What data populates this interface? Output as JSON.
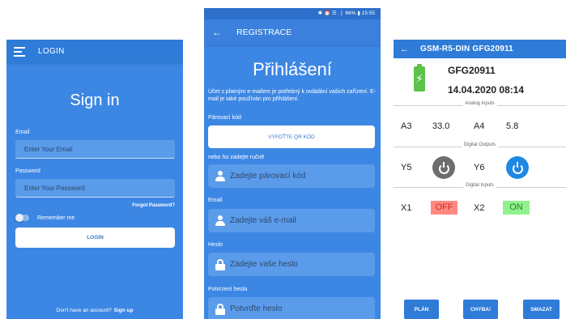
{
  "login": {
    "appbar_title": "LOGIN",
    "heading": "Sign in",
    "email_label": "Email",
    "email_placeholder": "Enter Your Email",
    "password_label": "Password",
    "password_placeholder": "Enter Your Password",
    "forgot_link": "Forgot Password?",
    "remember_label": "Remember me",
    "remember_on": false,
    "login_button": "LOGIN",
    "footer_text": "Don't have an account?",
    "signup_link": "Sign up"
  },
  "registration": {
    "status_text": "✱ ⏰ ☰ .❘ 66% ▮ 15:55",
    "appbar_title": "REGISTRACE",
    "heading": "Přihlášení",
    "description": "Účet s platným e-mailem je potřebný k ovládání vašich zařízení. E-mail je také používán pro přihlášení.",
    "pairing_label": "Párovací kód",
    "qr_button": "VYFOŤTE QR KÓD",
    "manual_label": "nebo ho zadejte ručně",
    "pairing_placeholder": "Zadejte párovací kód",
    "email_label": "Email",
    "email_placeholder": "Zadejte váš e-mail",
    "password_label": "Heslo",
    "password_placeholder": "Zadejte vaše heslo",
    "confirm_label": "Potvrzení hesla",
    "confirm_placeholder": "Potvrďte heslo"
  },
  "device": {
    "appbar_title": "GSM-R5-DIN GFG20911",
    "name": "GFG20911",
    "datetime": "14.04.2020 08:14",
    "analog_section": "Analog inputs",
    "analog": [
      {
        "label": "A3",
        "value": "33.0"
      },
      {
        "label": "A4",
        "value": "5.8"
      }
    ],
    "outputs_section": "Digital Outputs",
    "outputs": [
      {
        "label": "Y5",
        "state": "off"
      },
      {
        "label": "Y6",
        "state": "on"
      }
    ],
    "inputs_section": "Digital Inputs",
    "inputs": [
      {
        "label": "X1",
        "value": "OFF"
      },
      {
        "label": "X2",
        "value": "ON"
      }
    ],
    "buttons": [
      "PLÁN",
      "CHYBA!",
      "SMAZAT"
    ],
    "colors": {
      "accent": "#2f7bd8",
      "off_badge": "#ff8a80",
      "on_badge": "#8ff28d",
      "battery": "#5cc248"
    }
  }
}
